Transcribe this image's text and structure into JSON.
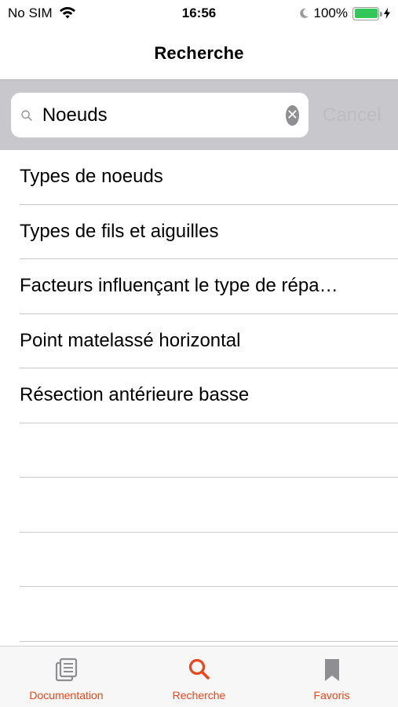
{
  "status_bar": {
    "carrier": "No SIM",
    "time": "16:56",
    "battery_percent": "100%",
    "battery_level": 1.0
  },
  "nav": {
    "title": "Recherche"
  },
  "search": {
    "value": "Noeuds",
    "cancel_label": "Cancel",
    "clear_symbol": "✕"
  },
  "results": [
    "Types de noeuds",
    "Types de fils et aiguilles",
    "Facteurs influençant le type de répa…",
    "Point matelassé horizontal",
    "Résection antérieure basse"
  ],
  "tab_bar": {
    "tabs": [
      {
        "label": "Documentation",
        "icon": "document-list-icon"
      },
      {
        "label": "Recherche",
        "icon": "search-icon"
      },
      {
        "label": "Favoris",
        "icon": "bookmark-icon"
      }
    ],
    "active_index": 1
  },
  "colors": {
    "accent": "#e8461b",
    "inactive_icon": "#8e8e93",
    "search_bar_bg": "#c8c8cc",
    "battery_green": "#33c759"
  }
}
